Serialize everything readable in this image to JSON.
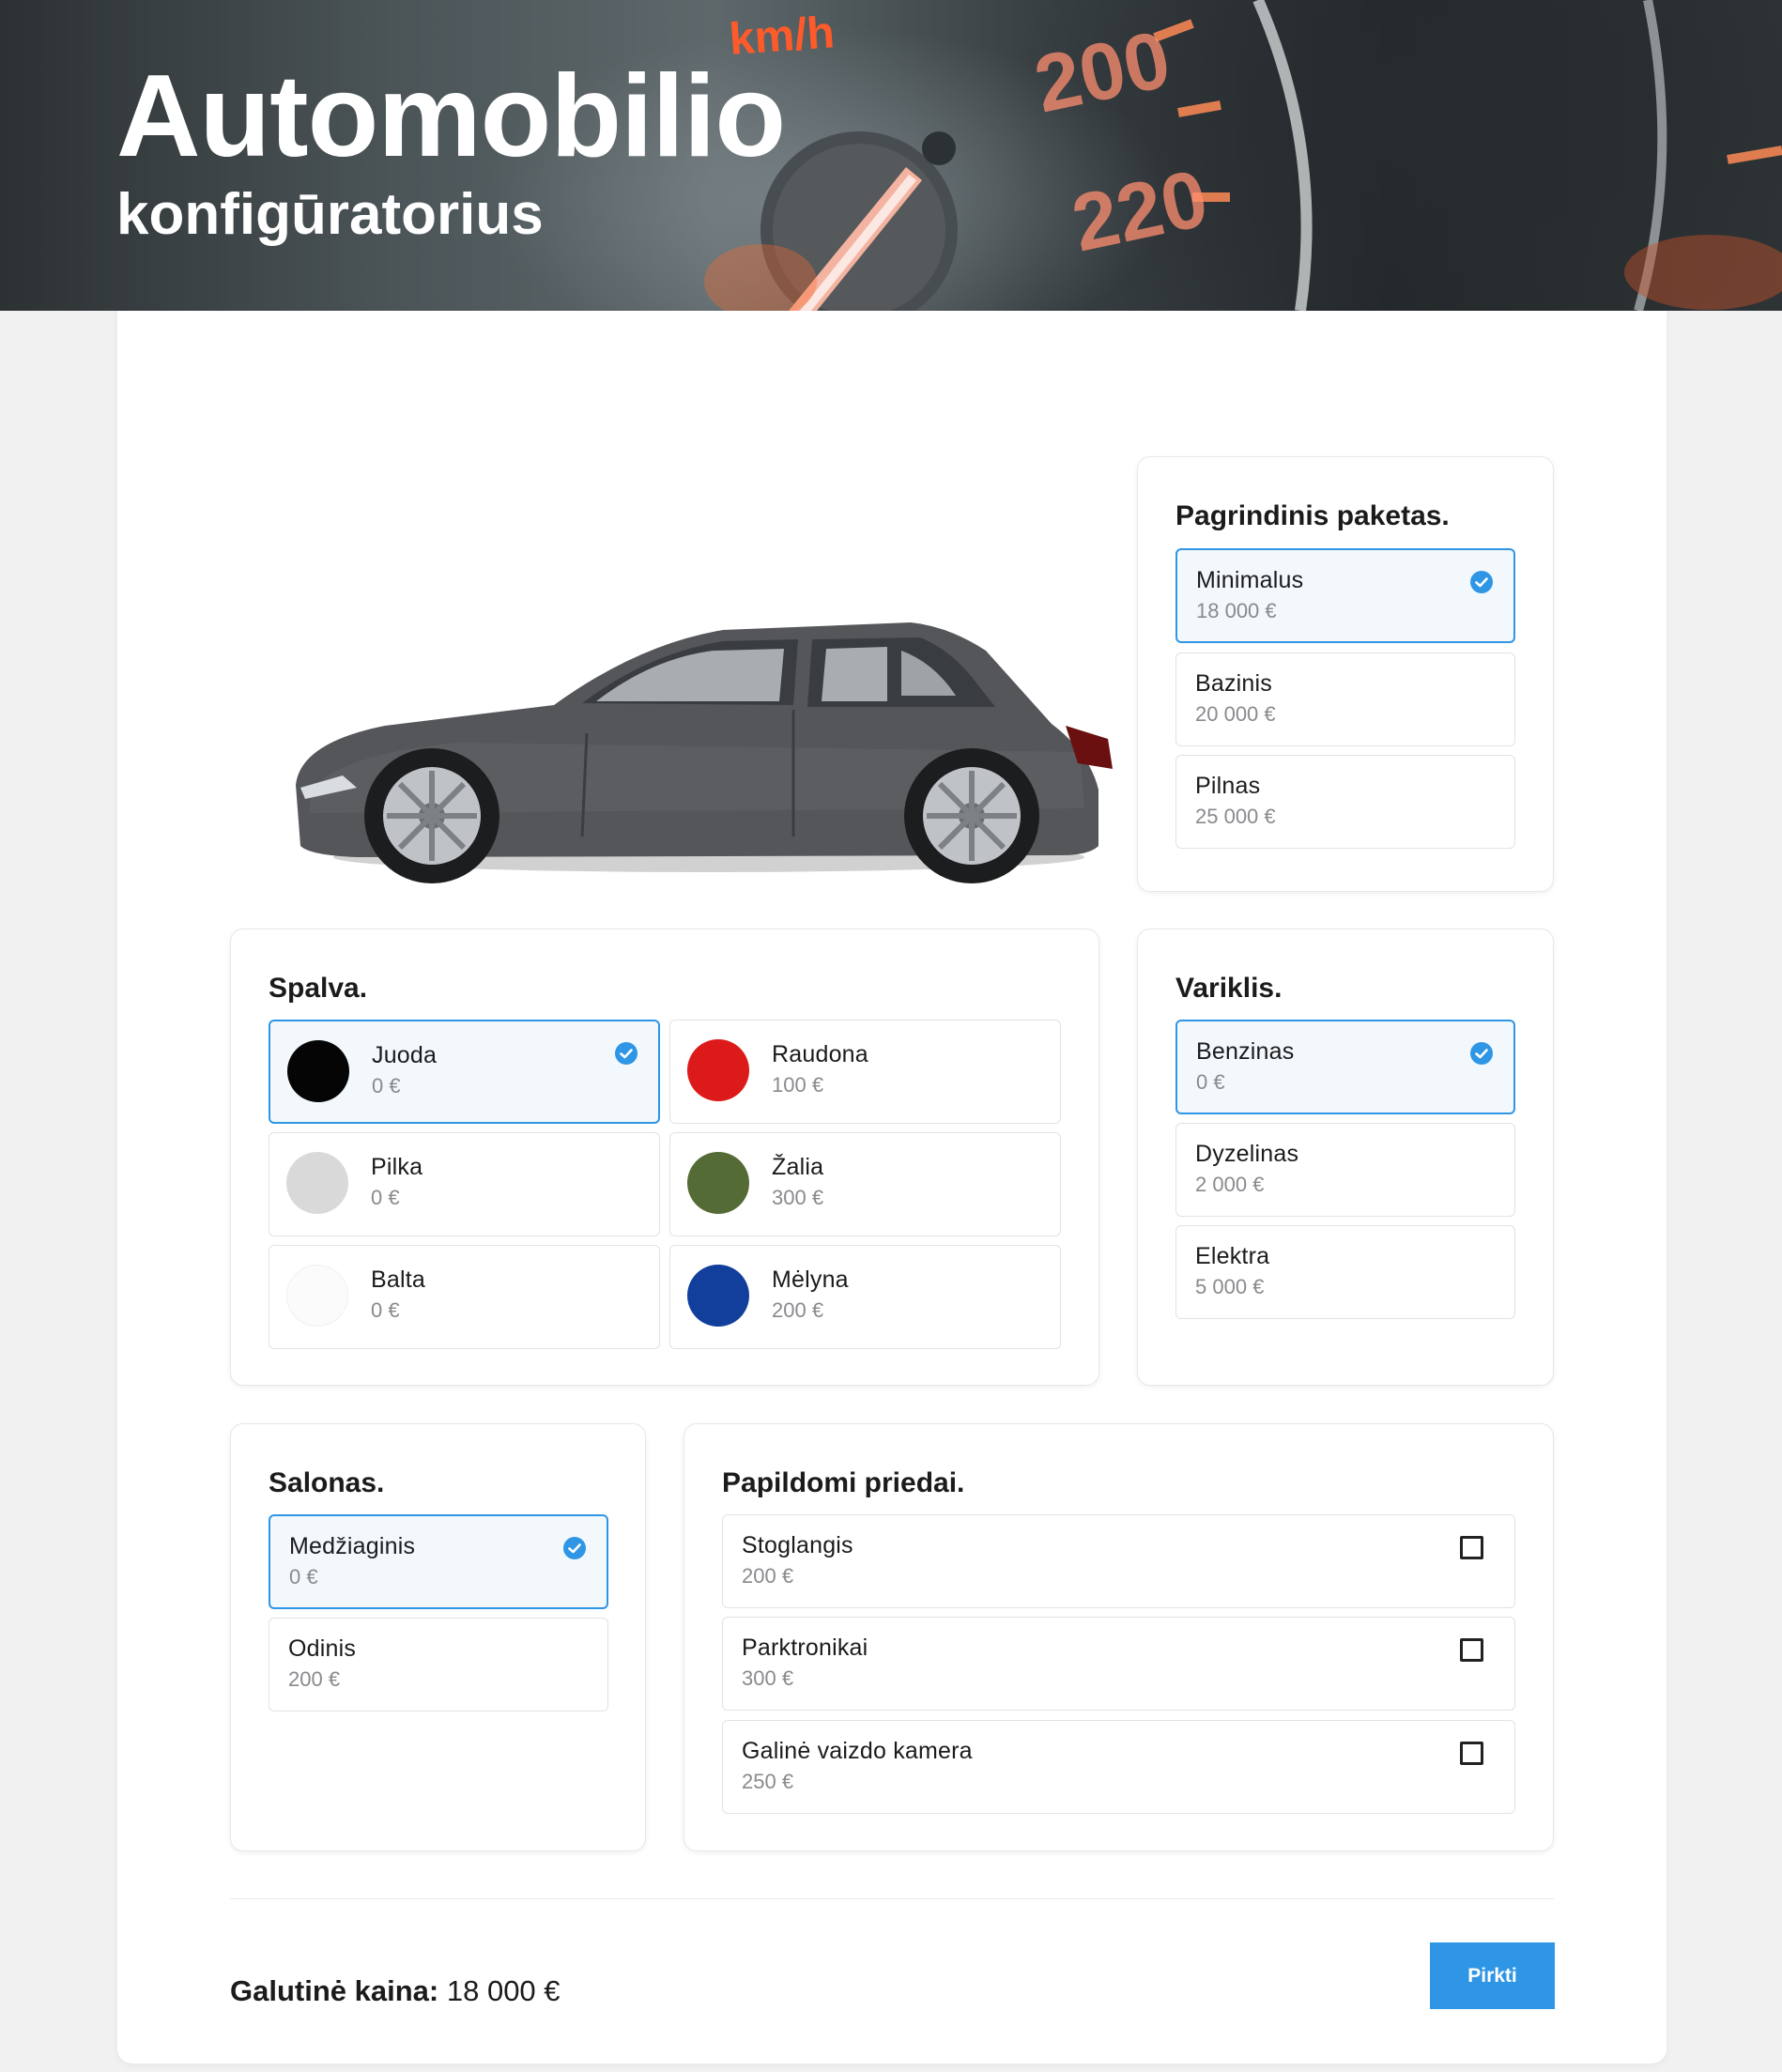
{
  "hero": {
    "title": "Automobilio",
    "subtitle": "konfigūratorius",
    "speedometer": {
      "unit": "km/h",
      "marks": [
        "200",
        "220"
      ]
    }
  },
  "car_image": {
    "alt": "car-side-view"
  },
  "package": {
    "title": "Pagrindinis paketas.",
    "options": [
      {
        "name": "Minimalus",
        "price": "18 000 €",
        "selected": true
      },
      {
        "name": "Bazinis",
        "price": "20 000 €",
        "selected": false
      },
      {
        "name": "Pilnas",
        "price": "25 000 €",
        "selected": false
      }
    ]
  },
  "color": {
    "title": "Spalva.",
    "options": [
      {
        "name": "Juoda",
        "price": "0 €",
        "swatch": "#050505",
        "selected": true
      },
      {
        "name": "Raudona",
        "price": "100 €",
        "swatch": "#dd1a1a",
        "selected": false
      },
      {
        "name": "Pilka",
        "price": "0 €",
        "swatch": "#d9d9d9",
        "selected": false
      },
      {
        "name": "Žalia",
        "price": "300 €",
        "swatch": "#556b35",
        "selected": false
      },
      {
        "name": "Balta",
        "price": "0 €",
        "swatch": "#fbfbfb",
        "selected": false
      },
      {
        "name": "Mėlyna",
        "price": "200 €",
        "swatch": "#123f9c",
        "selected": false
      }
    ]
  },
  "engine": {
    "title": "Variklis.",
    "options": [
      {
        "name": "Benzinas",
        "price": "0 €",
        "selected": true
      },
      {
        "name": "Dyzelinas",
        "price": "2 000 €",
        "selected": false
      },
      {
        "name": "Elektra",
        "price": "5 000 €",
        "selected": false
      }
    ]
  },
  "interior": {
    "title": "Salonas.",
    "options": [
      {
        "name": "Medžiaginis",
        "price": "0 €",
        "selected": true
      },
      {
        "name": "Odinis",
        "price": "200 €",
        "selected": false
      }
    ]
  },
  "extras": {
    "title": "Papildomi priedai.",
    "options": [
      {
        "name": "Stoglangis",
        "price": "200 €",
        "checked": false
      },
      {
        "name": "Parktronikai",
        "price": "300 €",
        "checked": false
      },
      {
        "name": "Galinė vaizdo kamera",
        "price": "250 €",
        "checked": false
      }
    ]
  },
  "summary": {
    "total_label": "Galutinė kaina:",
    "total_value": "18 000 €",
    "buy_label": "Pirkti"
  },
  "colors": {
    "accent": "#2f96e6",
    "selected_bg": "#f3f8fd",
    "muted_text": "#8a8a8f"
  }
}
